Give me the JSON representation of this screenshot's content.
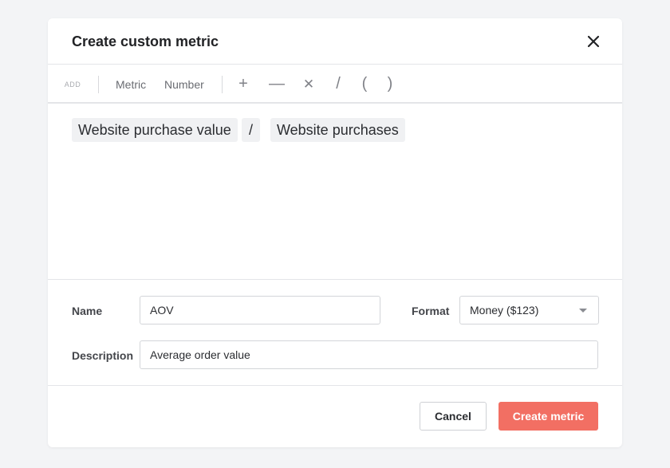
{
  "dialog": {
    "title": "Create custom metric"
  },
  "toolbar": {
    "add_label": "ADD",
    "metric_label": "Metric",
    "number_label": "Number",
    "operators": {
      "plus": "+",
      "minus": "—",
      "multiply": "✕",
      "divide": "/",
      "open_paren": "(",
      "close_paren": ")"
    }
  },
  "formula": {
    "tokens": [
      "Website purchase value",
      "/",
      "Website purchases"
    ]
  },
  "form": {
    "name_label": "Name",
    "name_value": "AOV",
    "format_label": "Format",
    "format_value": "Money ($123)",
    "description_label": "Description",
    "description_value": "Average order value"
  },
  "footer": {
    "cancel_label": "Cancel",
    "create_label": "Create metric"
  },
  "colors": {
    "accent": "#f26f63",
    "background": "#f3f4f6"
  }
}
